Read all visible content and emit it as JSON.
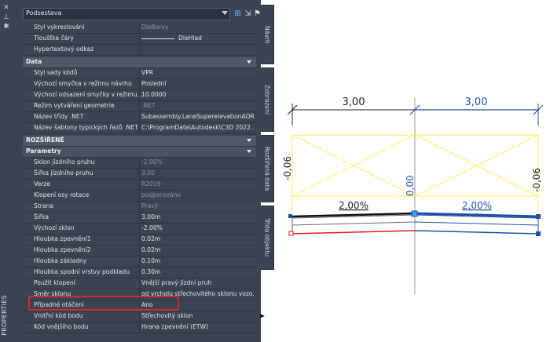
{
  "palette": {
    "title": "PROPERTIES",
    "icons": [
      "close-icon",
      "pin-icon",
      "settings-icon"
    ]
  },
  "selector": {
    "value": "Podsestava"
  },
  "groups": {
    "top": [
      {
        "name": "Styl vykreslování",
        "value": "DleBarvy",
        "readonly": true
      },
      {
        "name": "Tloušťka čáry",
        "value": "DleHlad",
        "readonly": false
      },
      {
        "name": "Hypertextový odkaz",
        "value": "",
        "readonly": false
      }
    ],
    "data_title": "Data",
    "data": [
      {
        "name": "Styl sady kódů",
        "value": "VPR",
        "readonly": false
      },
      {
        "name": "Výchozí smyčka v režimu návrhu",
        "value": "Poslední",
        "readonly": false
      },
      {
        "name": "Výchozí odsazení smyčky v režimu...",
        "value": "10.0000",
        "readonly": false
      },
      {
        "name": "Režim vytváření geometrie",
        "value": ".NET",
        "readonly": true
      },
      {
        "name": "Název třídy .NET",
        "value": "Subassembly.LaneSuperelevationAOR",
        "readonly": false
      },
      {
        "name": "Název šablony typických řezů .NET",
        "value": "C:\\ProgramData\\Autodesk\\C3D 2022...",
        "readonly": false
      }
    ],
    "ext_title": "ROZŠÍŘENÉ",
    "params_title": "Parametry",
    "params": [
      {
        "name": "Sklon jízdního pruhu",
        "value": "-2.00%",
        "readonly": true
      },
      {
        "name": "Šířka jízdního pruhu",
        "value": "3.00",
        "readonly": true
      },
      {
        "name": "Verze",
        "value": "R2019",
        "readonly": true
      },
      {
        "name": "Klopení osy rotace",
        "value": "podporováno",
        "readonly": true
      },
      {
        "name": "Strana",
        "value": "Pravý",
        "readonly": true
      },
      {
        "name": "Šířka",
        "value": "3.00m",
        "readonly": false
      },
      {
        "name": "Výchozí sklon",
        "value": "-2.00%",
        "readonly": false
      },
      {
        "name": "Hloubka zpevnění1",
        "value": "0.02m",
        "readonly": false
      },
      {
        "name": "Hloubka zpevnění2",
        "value": "0.02m",
        "readonly": false
      },
      {
        "name": "Hloubka základny",
        "value": "0.10m",
        "readonly": false
      },
      {
        "name": "Hloubka spodní vrstvy podkladu",
        "value": "0.30m",
        "readonly": false
      },
      {
        "name": "Použít klopení",
        "value": "Vnější pravý jízdní pruh",
        "readonly": false
      },
      {
        "name": "Směr sklonu",
        "value": "od vrcholu střechovitého sklonu vozo...",
        "readonly": false
      },
      {
        "name": "Případné otáčení",
        "value": "Ano",
        "readonly": false
      },
      {
        "name": "Vnitřní kód bodu",
        "value": "Střechovitý sklon",
        "readonly": false
      },
      {
        "name": "Kód vnějšího bodu",
        "value": "Hrana zpevnění (ETW)",
        "readonly": false
      }
    ]
  },
  "tabs": [
    "Návrh",
    "Zobrazení",
    "Rozšířená data",
    "Třída objektu"
  ],
  "drawing": {
    "dim_left": "3,00",
    "dim_right": "3,00",
    "left_offset": "-0,06",
    "right_offset": "-0,06",
    "center_value": "0,00",
    "slope_left": "2,00%",
    "slope_right": "2,00%",
    "colors": {
      "yellow": "#f2ef5a",
      "blue": "#1f4fa8",
      "red": "#e31b1b",
      "black": "#111111",
      "gray": "#9a9a9a"
    }
  }
}
